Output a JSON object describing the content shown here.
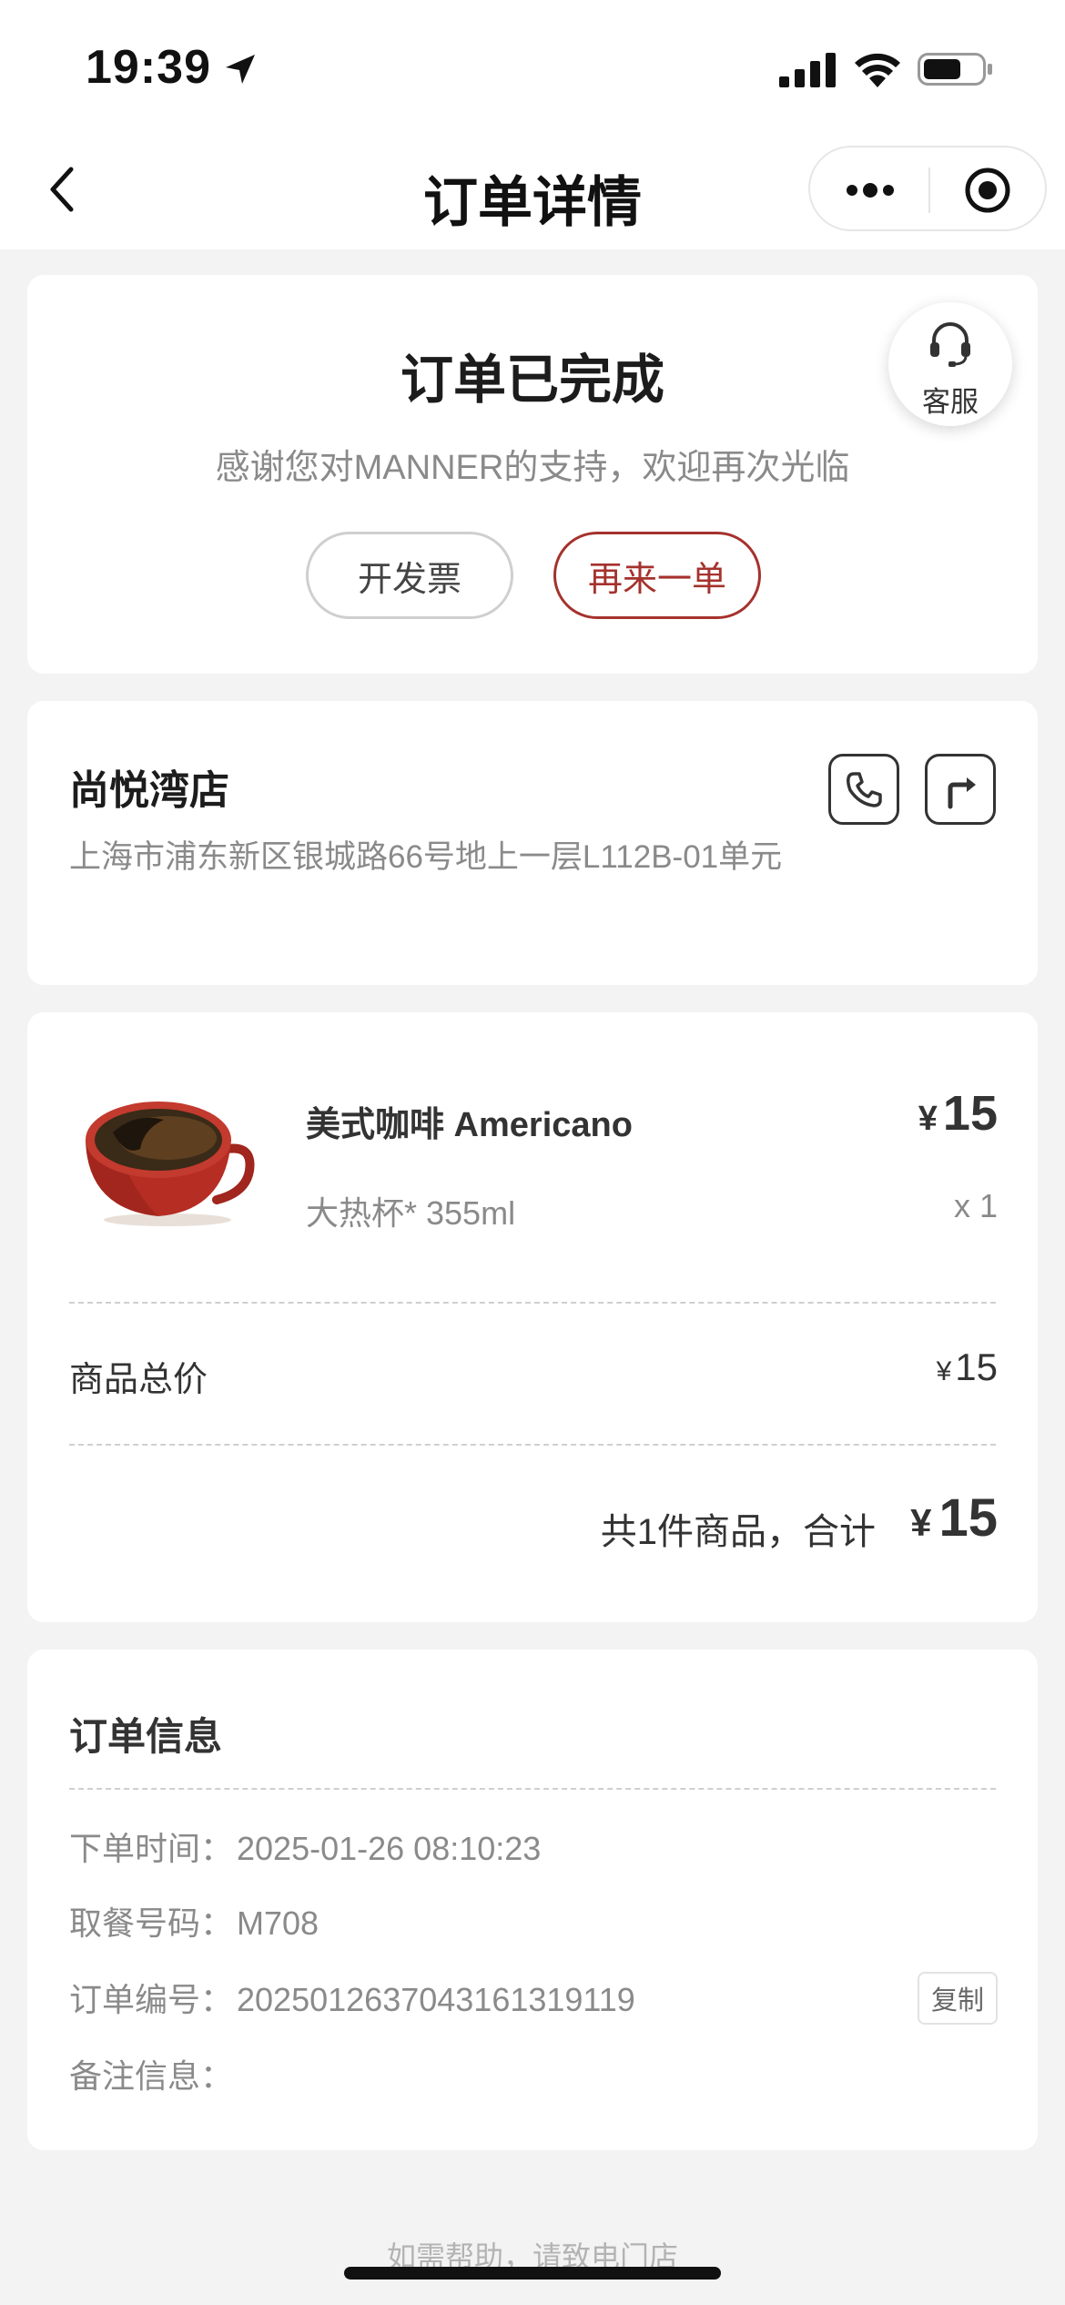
{
  "status_bar": {
    "time": "19:39"
  },
  "nav": {
    "title": "订单详情"
  },
  "order_status": {
    "title": "订单已完成",
    "subtitle": "感谢您对MANNER的支持，欢迎再次光临",
    "invoice_label": "开发票",
    "reorder_label": "再来一单",
    "customer_service_label": "客服"
  },
  "store": {
    "name": "尚悦湾店",
    "address": "上海市浦东新区银城路66号地上一层L112B-01单元"
  },
  "product": {
    "name": "美式咖啡 Americano",
    "currency": "¥",
    "price": "15",
    "spec": "大热杯* 355ml",
    "quantity": "x 1"
  },
  "summary": {
    "subtotal_label": "商品总价",
    "subtotal_currency": "¥",
    "subtotal_value": "15",
    "total_label": "共1件商品，合计",
    "total_currency": "¥",
    "total_value": "15"
  },
  "order_info": {
    "title": "订单信息",
    "order_time_label": "下单时间：",
    "order_time": "2025-01-26 08:10:23",
    "pickup_code_label": "取餐号码：",
    "pickup_code": "M708",
    "order_number_label": "订单编号：",
    "order_number": "2025012637043161319119",
    "copy_label": "复制",
    "remark_label": "备注信息："
  },
  "footer": {
    "help_text": "如需帮助，请致电门店"
  },
  "colors": {
    "accent": "#a5322d",
    "background": "#f3f3f3"
  }
}
